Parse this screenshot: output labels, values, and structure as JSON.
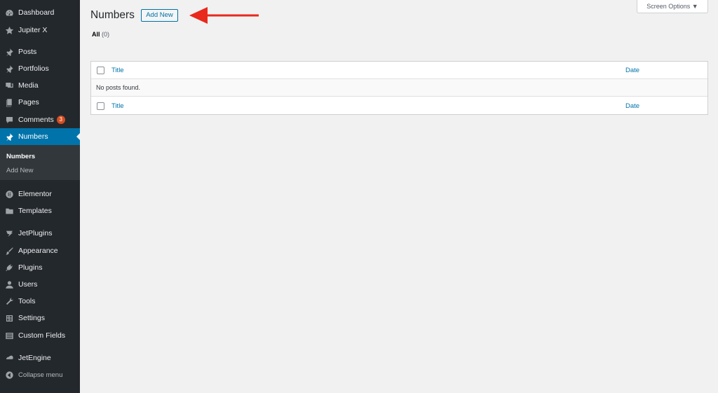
{
  "sidebar": {
    "items": [
      {
        "label": "Dashboard",
        "icon": "dashboard-icon"
      },
      {
        "label": "Jupiter X",
        "icon": "star-icon"
      },
      {
        "label": "Posts",
        "icon": "pin-icon"
      },
      {
        "label": "Portfolios",
        "icon": "pin-icon"
      },
      {
        "label": "Media",
        "icon": "media-icon"
      },
      {
        "label": "Pages",
        "icon": "pages-icon"
      },
      {
        "label": "Comments",
        "icon": "comment-icon",
        "badge": "3"
      },
      {
        "label": "Numbers",
        "icon": "pin-icon",
        "active": true
      },
      {
        "label": "Elementor",
        "icon": "elementor-icon"
      },
      {
        "label": "Templates",
        "icon": "folder-icon"
      },
      {
        "label": "JetPlugins",
        "icon": "jetplugins-icon"
      },
      {
        "label": "Appearance",
        "icon": "brush-icon"
      },
      {
        "label": "Plugins",
        "icon": "plug-icon"
      },
      {
        "label": "Users",
        "icon": "user-icon"
      },
      {
        "label": "Tools",
        "icon": "wrench-icon"
      },
      {
        "label": "Settings",
        "icon": "settings-icon"
      },
      {
        "label": "Custom Fields",
        "icon": "table-icon"
      },
      {
        "label": "JetEngine",
        "icon": "jetengine-icon"
      },
      {
        "label": "Collapse menu",
        "icon": "collapse-icon"
      }
    ],
    "submenu": {
      "current": "Numbers",
      "add_new": "Add New"
    }
  },
  "main": {
    "title": "Numbers",
    "add_new_label": "Add New",
    "screen_options_label": "Screen Options ▼",
    "filter_all_label": "All",
    "filter_all_count": "(0)",
    "table": {
      "col_title": "Title",
      "col_date": "Date",
      "empty_message": "No posts found."
    }
  },
  "colors": {
    "sidebar_bg": "#23282d",
    "active_bg": "#0073aa",
    "link": "#0073aa",
    "arrow": "#e8291c",
    "badge": "#d54e21"
  }
}
